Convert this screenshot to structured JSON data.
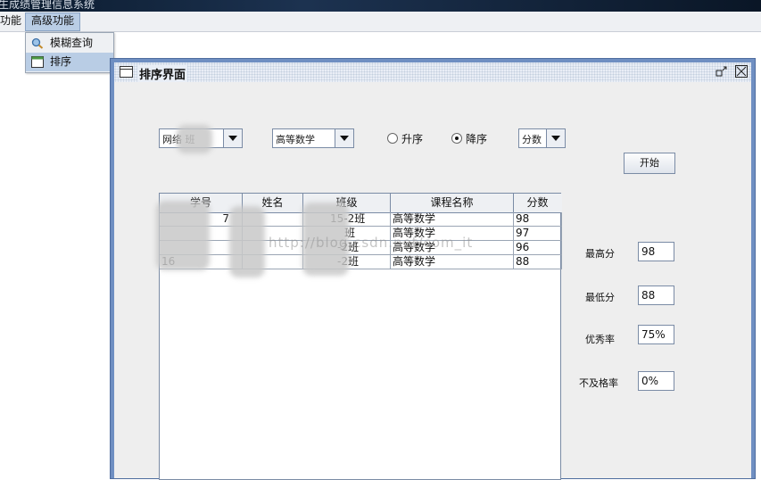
{
  "app": {
    "title": "生成绩管理信息系统"
  },
  "menubar": {
    "items": [
      "功能",
      "高级功能"
    ]
  },
  "dropdown": {
    "items": [
      {
        "label": "模糊查询",
        "icon": "search-icon"
      },
      {
        "label": "排序",
        "icon": "window-icon"
      }
    ]
  },
  "iframe": {
    "title": "排序界面"
  },
  "controls": {
    "class_combo": "网络 班",
    "course_combo": "高等数学",
    "asc_label": "升序",
    "desc_label": "降序",
    "sort_selected": "降序",
    "field_combo": "分数",
    "start_button": "开始"
  },
  "table": {
    "headers": [
      "学号",
      "姓名",
      "班级",
      "课程名称",
      "分数"
    ],
    "rows": [
      [
        "7",
        "",
        "15-2班",
        "高等数学",
        "98"
      ],
      [
        "",
        "",
        "班",
        "高等数学",
        "97"
      ],
      [
        "",
        "",
        "-2班",
        "高等数学",
        "96"
      ],
      [
        "16",
        "",
        "-2班",
        "高等数学",
        "88"
      ]
    ]
  },
  "watermark": "http://blog.csdn.net/com_it",
  "stats": {
    "max_label": "最高分",
    "max_value": "98",
    "min_label": "最低分",
    "min_value": "88",
    "excellent_label": "优秀率",
    "excellent_value": "75%",
    "fail_label": "不及格率",
    "fail_value": "0%"
  }
}
